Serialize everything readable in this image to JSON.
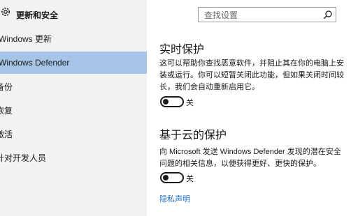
{
  "sidebar": {
    "title": "更新和安全",
    "items": [
      {
        "label": "Windows 更新"
      },
      {
        "label": "Windows Defender"
      },
      {
        "label": "备份"
      },
      {
        "label": "恢复"
      },
      {
        "label": "激活"
      },
      {
        "label": "针对开发人员"
      }
    ]
  },
  "search": {
    "placeholder": "查找设置"
  },
  "realtime": {
    "heading": "实时保护",
    "description": "这可以帮助你查找恶意软件，并阻止其在你的电脑上安装或运行。你可以短暂关闭此功能，但如果关闭时间较长，我们会自动重新启用它。",
    "toggle_label": "关",
    "toggle_on": false
  },
  "cloud": {
    "heading": "基于云的保护",
    "description": "向 Microsoft 发送 Windows Defender 发现的潜在安全问题的相关信息，以便获得更好、更快的保护。",
    "toggle_label": "关",
    "toggle_on": false
  },
  "privacy_link": "隐私声明",
  "colors": {
    "accent": "#1d6fc7",
    "active_nav": "#a6c5e6",
    "sidebar_bg": "#f2f2f2"
  }
}
